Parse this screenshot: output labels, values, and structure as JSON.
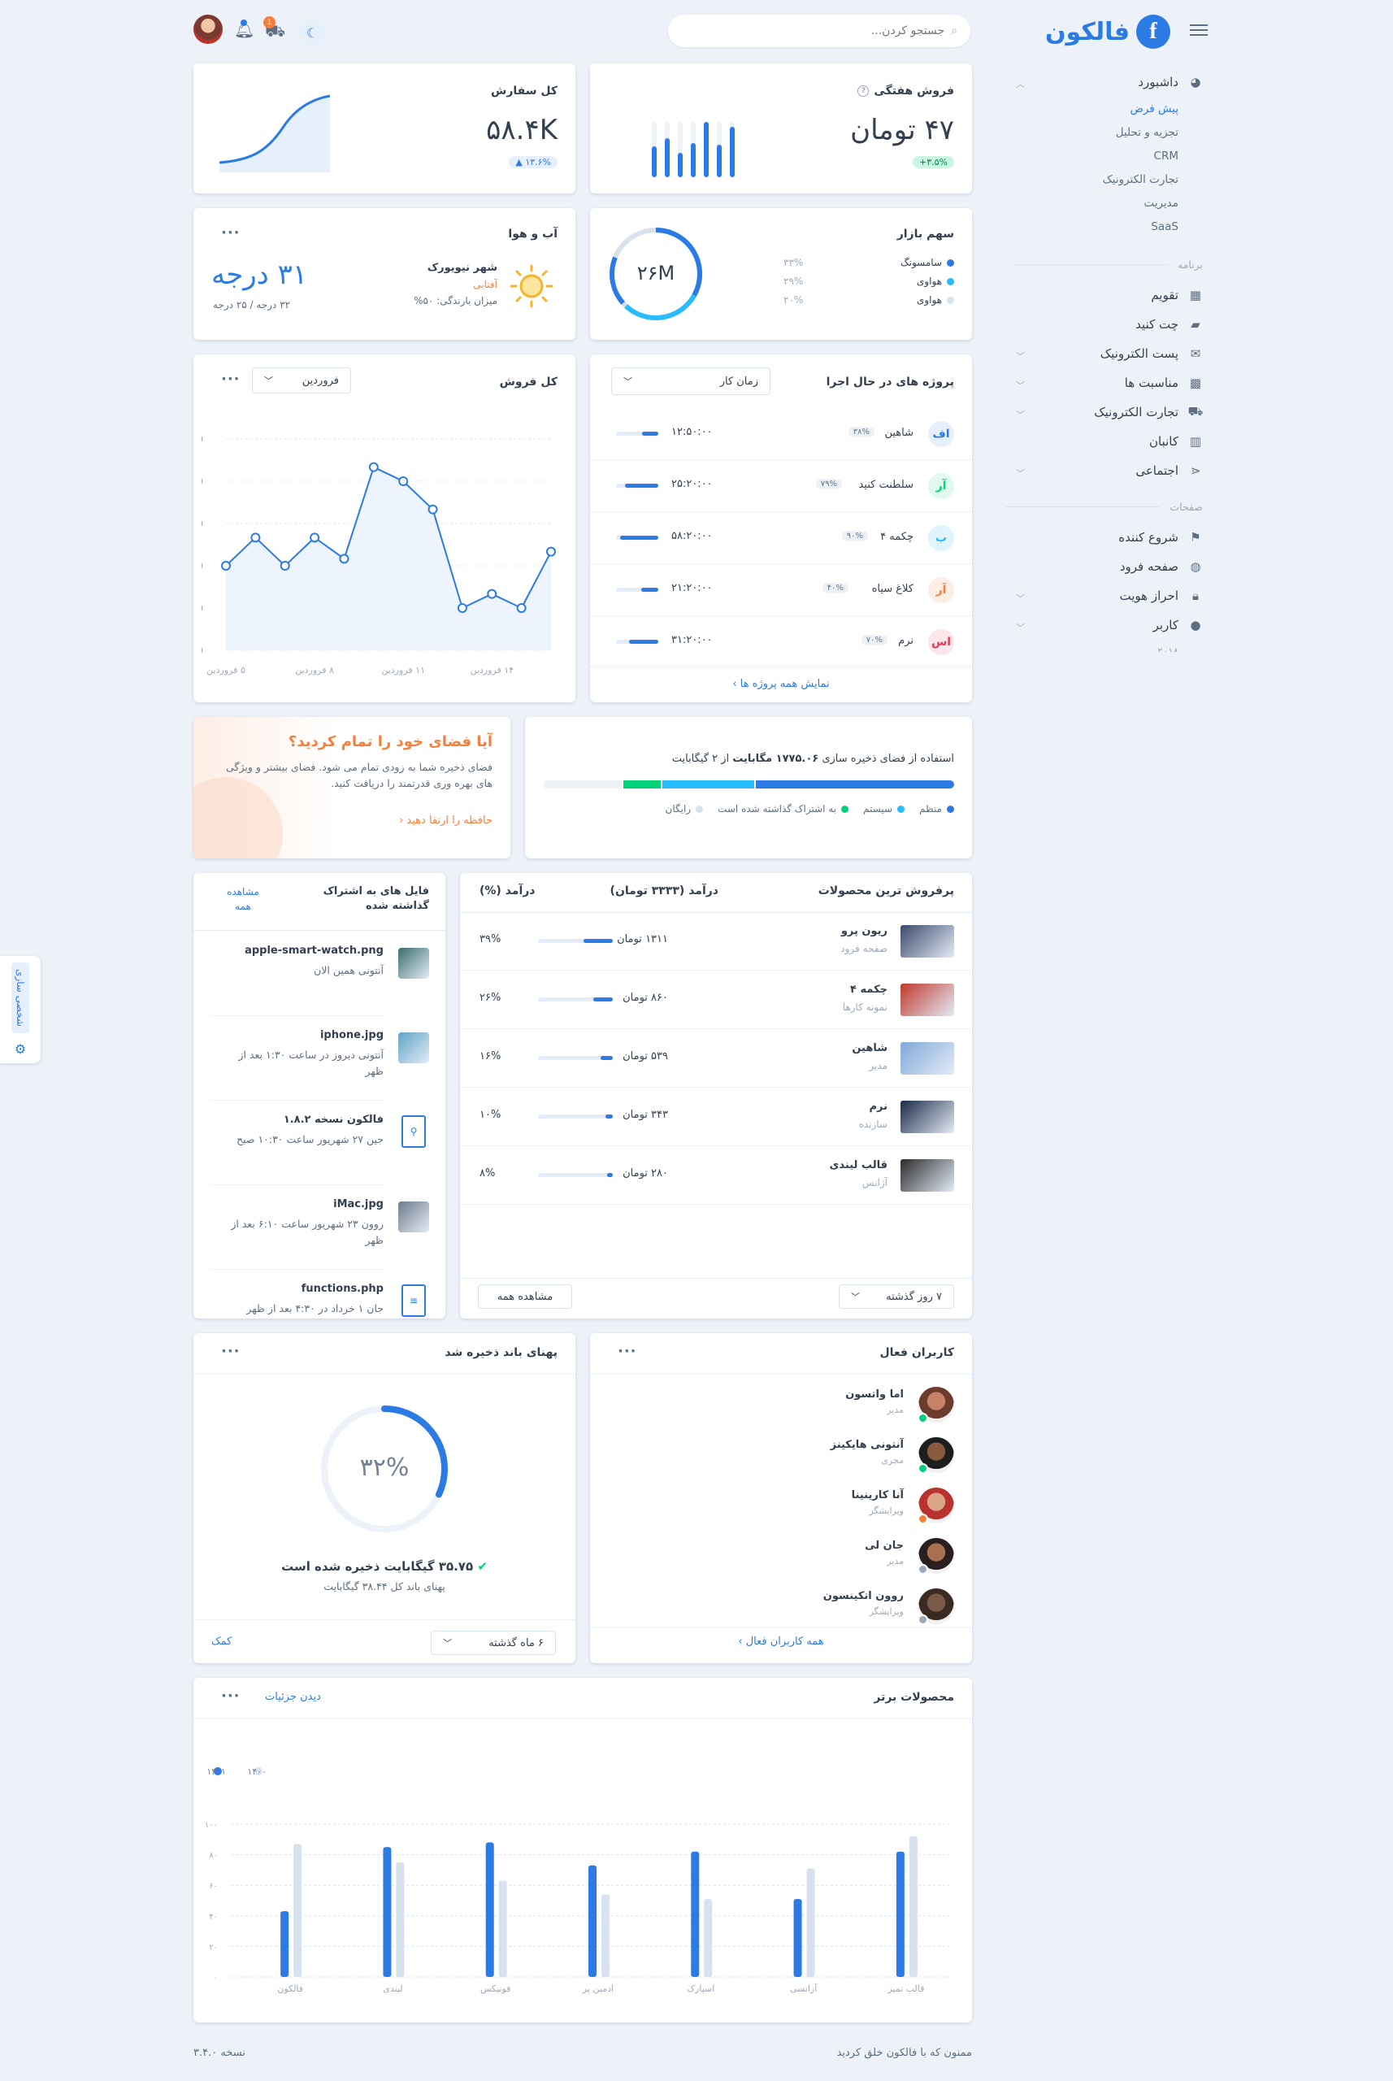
{
  "brand": {
    "name": "فالکون",
    "logo_letter": "f"
  },
  "topbar": {
    "search_placeholder": "جستجو کردن...",
    "cart_count": "1"
  },
  "sidebar": {
    "dashboard": {
      "label": "داشبورد",
      "subs": [
        "پیش فرض",
        "تجزیه و تحلیل",
        "CRM",
        "تجارت الکترونیک",
        "مدیریت",
        "SaaS"
      ]
    },
    "app_section": "برنامه",
    "app_items": [
      "تقویم",
      "چت کنید",
      "پست الکترونیک",
      "مناسبت ها",
      "تجارت الکترونیک",
      "کانبان",
      "اجتماعی"
    ],
    "pages_section": "صفحات",
    "pages_items": [
      "شروع کننده",
      "صفحه فرود",
      "احراز هویت",
      "کاربر"
    ],
    "cut_item": "۲۰۱۸"
  },
  "customize_tab": "شخصی سازی",
  "weekly_sales": {
    "title": "فروش هفتگی",
    "value": "۴۷ تومان",
    "badge": "۳.۵%+"
  },
  "total_order": {
    "title": "کل سفارش",
    "value": "۵۸.۴K",
    "badge": "۱۳.۶% ▲"
  },
  "market_share": {
    "title": "سهم بازار",
    "center": "۲۶M",
    "items": [
      {
        "name": "سامسونگ",
        "pct": "۳۳%",
        "color": "#2c7be5"
      },
      {
        "name": "هواوی",
        "pct": "۲۹%",
        "color": "#27bcfd"
      },
      {
        "name": "هواوی",
        "pct": "۲۰%",
        "color": "#d8e2ef"
      }
    ]
  },
  "weather": {
    "title": "آب و هوا",
    "city": "شهر نیویورک",
    "condition": "آفتابی",
    "precip": "میزان بارندگی: ۵۰%",
    "temp": "۳۱ درجه",
    "range": "۳۲ درجه / ۲۵ درجه"
  },
  "projects": {
    "title": "پروژه های در حال اجرا",
    "select": "زمان کار",
    "rows": [
      {
        "initials": "اف",
        "name": "شاهین",
        "pct": "۳۸%",
        "time": "۱۲:۵۰:۰۰",
        "bg": "#e6effc",
        "fg": "#2c7be5"
      },
      {
        "initials": "آر",
        "name": "سلطنت کنید",
        "pct": "۷۹%",
        "time": "۲۵:۲۰:۰۰",
        "bg": "#e0faef",
        "fg": "#00d27a"
      },
      {
        "initials": "ب",
        "name": "چکمه ۴",
        "pct": "۹۰%",
        "time": "۵۸:۲۰:۰۰",
        "bg": "#e0f4fe",
        "fg": "#27bcfd"
      },
      {
        "initials": "آر",
        "name": "کلاغ سیاه",
        "pct": "۴۰%",
        "time": "۲۱:۲۰:۰۰",
        "bg": "#fdeee5",
        "fg": "#f5803e"
      },
      {
        "initials": "اس",
        "name": "نرم",
        "pct": "۷۰%",
        "time": "۳۱:۲۰:۰۰",
        "bg": "#fde6ea",
        "fg": "#e63757"
      }
    ],
    "footer": "نمایش همه پروژه ها"
  },
  "total_sales": {
    "title": "کل فروش",
    "select": "فروردین"
  },
  "chart_data": [
    {
      "type": "line",
      "title": "کل فروش",
      "x": [
        1,
        2,
        3,
        4,
        5,
        6,
        7,
        8,
        9,
        10,
        11,
        12
      ],
      "y": [
        60,
        80,
        60,
        80,
        65,
        130,
        120,
        100,
        30,
        40,
        30,
        70
      ],
      "ylim": [
        0,
        150
      ],
      "yticks": [
        "150",
        "120",
        "90",
        "60",
        "30",
        "0"
      ],
      "xtick_labels": [
        "۵ فروردین",
        "۸ فروردین",
        "۱۱ فروردین",
        "۱۴ فروردین"
      ],
      "grid": true
    },
    {
      "type": "bar",
      "title": "محصولات برتر",
      "categories": [
        "فالکون",
        "لیندی",
        "فونیکس",
        "ادمین پر",
        "اسپارک",
        "آزانسی",
        "قالب تمیز"
      ],
      "series": [
        {
          "name": "۱۴۰۱",
          "values": [
            43,
            85,
            88,
            73,
            82,
            51,
            82
          ],
          "color": "#2c7be5"
        },
        {
          "name": "۱۴۰۰",
          "values": [
            87,
            75,
            63,
            54,
            51,
            71,
            92
          ],
          "color": "#d8e2ef"
        }
      ],
      "yticks": [
        "۱۰۰",
        "۸۰",
        "۶۰",
        "۴۰",
        "۲۰",
        "۰"
      ],
      "ylim": [
        0,
        100
      ]
    }
  ],
  "storage": {
    "title_pre": "استفاده از فضای ذخیره سازی",
    "title_bold": "۱۷۷۵.۰۶ مگابایت",
    "title_post": "از ۲ گیگابایت",
    "segments": [
      {
        "name": "منظم",
        "pct": 48.8,
        "color": "#2c7be5"
      },
      {
        "name": "سیستم",
        "pct": 22.5,
        "color": "#27bcfd"
      },
      {
        "name": "به اشتراک گذاشته شده است",
        "pct": 9.3,
        "color": "#00d27a"
      },
      {
        "name": "رایگان",
        "pct": 19.4,
        "color": "#edf2f9"
      }
    ]
  },
  "upgrade": {
    "title": "آیا فضای خود را تمام کردید؟",
    "text": "فضای ذخیره شما به زودی تمام می شود. فضای بیشتر و ویژگی های بهره وری قدرتمند را دریافت کنید.",
    "link": "حافظه را ارتقا دهید"
  },
  "top_products": {
    "title": "پرفروش ترین محصولات",
    "col_revenue": "درآمد (۳۳۳۳ تومان)",
    "col_pct": "درآمد (%)",
    "rows": [
      {
        "name": "ریون پرو",
        "cat": "صفحه فرود",
        "revenue": "۱۳۱۱ تومان",
        "pct": "۳۹%",
        "frac": 0.39
      },
      {
        "name": "چکمه ۴",
        "cat": "نمونه کارها",
        "revenue": "۸۶۰ تومان",
        "pct": "۲۶%",
        "frac": 0.26
      },
      {
        "name": "شاهین",
        "cat": "مدیر",
        "revenue": "۵۳۹ تومان",
        "pct": "۱۶%",
        "frac": 0.16
      },
      {
        "name": "نرم",
        "cat": "سازنده",
        "revenue": "۳۴۳ تومان",
        "pct": "۱۰%",
        "frac": 0.1
      },
      {
        "name": "قالب لیندی",
        "cat": "آژانس",
        "revenue": "۲۸۰ تومان",
        "pct": "۸%",
        "frac": 0.08
      }
    ],
    "select": "۷ روز گذشته",
    "view_all": "مشاهده همه"
  },
  "shared_files": {
    "title": "فایل های به اشتراک گذاشته شده",
    "view_all": "مشاهده همه",
    "files": [
      {
        "name": "apple-smart-watch.png",
        "meta": "آنتونی   همین الان"
      },
      {
        "name": "iphone.jpg",
        "meta": "آنتونی   دیروز در ساعت ۱:۳۰ بعد از ظهر"
      },
      {
        "name": "فالکون نسخه ۱.۸.۲",
        "meta": "جین   ۲۷ شهریور ساعت ۱۰:۳۰ صبح"
      },
      {
        "name": "iMac.jpg",
        "meta": "روون   ۲۳ شهریور ساعت ۶:۱۰ بعد از ظهر"
      },
      {
        "name": "functions.php",
        "meta": "جان   ۱ خرداد در ۴:۳۰ بعد از ظهر"
      }
    ]
  },
  "active_users": {
    "title": "کاربران فعال",
    "users": [
      {
        "name": "اما واتسون",
        "role": "مدیر",
        "status": "#00d27a"
      },
      {
        "name": "آنتونی هایکینز",
        "role": "مجری",
        "status": "#00d27a"
      },
      {
        "name": "آنا کارینینا",
        "role": "ویرایشگر",
        "status": "#f5803e"
      },
      {
        "name": "جان لی",
        "role": "مدیر",
        "status": "#9da9bb"
      },
      {
        "name": "روون اتکینسون",
        "role": "ویرایشگر",
        "status": "#9da9bb"
      }
    ],
    "footer": "همه کاربران فعال"
  },
  "bandwidth": {
    "title": "پهنای باند ذخیره شد",
    "pct": "۳۲%",
    "frac": 0.32,
    "saved": "۳۵.۷۵ گیگابایت ذخیره شده است",
    "total": "پهنای باند کل ۳۸.۴۴ گیگابایت",
    "select": "۶ ماه گذشته",
    "help": "کمک"
  },
  "top_products_chart": {
    "title": "محصولات برتر",
    "link": "دیدن جزئیات"
  },
  "footer": {
    "thanks": "ممنون که با فالکون خلق کردید",
    "version": "نسخه ۳.۴.۰"
  }
}
